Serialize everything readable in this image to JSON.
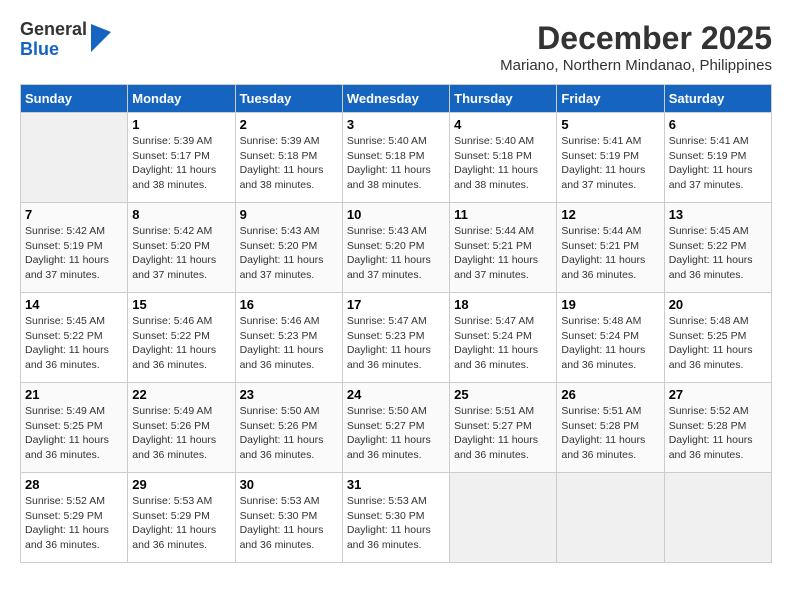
{
  "logo": {
    "general": "General",
    "blue": "Blue"
  },
  "header": {
    "month": "December 2025",
    "location": "Mariano, Northern Mindanao, Philippines"
  },
  "columns": [
    "Sunday",
    "Monday",
    "Tuesday",
    "Wednesday",
    "Thursday",
    "Friday",
    "Saturday"
  ],
  "weeks": [
    [
      {
        "day": "",
        "sunrise": "",
        "sunset": "",
        "daylight": ""
      },
      {
        "day": "1",
        "sunrise": "Sunrise: 5:39 AM",
        "sunset": "Sunset: 5:17 PM",
        "daylight": "Daylight: 11 hours and 38 minutes."
      },
      {
        "day": "2",
        "sunrise": "Sunrise: 5:39 AM",
        "sunset": "Sunset: 5:18 PM",
        "daylight": "Daylight: 11 hours and 38 minutes."
      },
      {
        "day": "3",
        "sunrise": "Sunrise: 5:40 AM",
        "sunset": "Sunset: 5:18 PM",
        "daylight": "Daylight: 11 hours and 38 minutes."
      },
      {
        "day": "4",
        "sunrise": "Sunrise: 5:40 AM",
        "sunset": "Sunset: 5:18 PM",
        "daylight": "Daylight: 11 hours and 38 minutes."
      },
      {
        "day": "5",
        "sunrise": "Sunrise: 5:41 AM",
        "sunset": "Sunset: 5:19 PM",
        "daylight": "Daylight: 11 hours and 37 minutes."
      },
      {
        "day": "6",
        "sunrise": "Sunrise: 5:41 AM",
        "sunset": "Sunset: 5:19 PM",
        "daylight": "Daylight: 11 hours and 37 minutes."
      }
    ],
    [
      {
        "day": "7",
        "sunrise": "Sunrise: 5:42 AM",
        "sunset": "Sunset: 5:19 PM",
        "daylight": "Daylight: 11 hours and 37 minutes."
      },
      {
        "day": "8",
        "sunrise": "Sunrise: 5:42 AM",
        "sunset": "Sunset: 5:20 PM",
        "daylight": "Daylight: 11 hours and 37 minutes."
      },
      {
        "day": "9",
        "sunrise": "Sunrise: 5:43 AM",
        "sunset": "Sunset: 5:20 PM",
        "daylight": "Daylight: 11 hours and 37 minutes."
      },
      {
        "day": "10",
        "sunrise": "Sunrise: 5:43 AM",
        "sunset": "Sunset: 5:20 PM",
        "daylight": "Daylight: 11 hours and 37 minutes."
      },
      {
        "day": "11",
        "sunrise": "Sunrise: 5:44 AM",
        "sunset": "Sunset: 5:21 PM",
        "daylight": "Daylight: 11 hours and 37 minutes."
      },
      {
        "day": "12",
        "sunrise": "Sunrise: 5:44 AM",
        "sunset": "Sunset: 5:21 PM",
        "daylight": "Daylight: 11 hours and 36 minutes."
      },
      {
        "day": "13",
        "sunrise": "Sunrise: 5:45 AM",
        "sunset": "Sunset: 5:22 PM",
        "daylight": "Daylight: 11 hours and 36 minutes."
      }
    ],
    [
      {
        "day": "14",
        "sunrise": "Sunrise: 5:45 AM",
        "sunset": "Sunset: 5:22 PM",
        "daylight": "Daylight: 11 hours and 36 minutes."
      },
      {
        "day": "15",
        "sunrise": "Sunrise: 5:46 AM",
        "sunset": "Sunset: 5:22 PM",
        "daylight": "Daylight: 11 hours and 36 minutes."
      },
      {
        "day": "16",
        "sunrise": "Sunrise: 5:46 AM",
        "sunset": "Sunset: 5:23 PM",
        "daylight": "Daylight: 11 hours and 36 minutes."
      },
      {
        "day": "17",
        "sunrise": "Sunrise: 5:47 AM",
        "sunset": "Sunset: 5:23 PM",
        "daylight": "Daylight: 11 hours and 36 minutes."
      },
      {
        "day": "18",
        "sunrise": "Sunrise: 5:47 AM",
        "sunset": "Sunset: 5:24 PM",
        "daylight": "Daylight: 11 hours and 36 minutes."
      },
      {
        "day": "19",
        "sunrise": "Sunrise: 5:48 AM",
        "sunset": "Sunset: 5:24 PM",
        "daylight": "Daylight: 11 hours and 36 minutes."
      },
      {
        "day": "20",
        "sunrise": "Sunrise: 5:48 AM",
        "sunset": "Sunset: 5:25 PM",
        "daylight": "Daylight: 11 hours and 36 minutes."
      }
    ],
    [
      {
        "day": "21",
        "sunrise": "Sunrise: 5:49 AM",
        "sunset": "Sunset: 5:25 PM",
        "daylight": "Daylight: 11 hours and 36 minutes."
      },
      {
        "day": "22",
        "sunrise": "Sunrise: 5:49 AM",
        "sunset": "Sunset: 5:26 PM",
        "daylight": "Daylight: 11 hours and 36 minutes."
      },
      {
        "day": "23",
        "sunrise": "Sunrise: 5:50 AM",
        "sunset": "Sunset: 5:26 PM",
        "daylight": "Daylight: 11 hours and 36 minutes."
      },
      {
        "day": "24",
        "sunrise": "Sunrise: 5:50 AM",
        "sunset": "Sunset: 5:27 PM",
        "daylight": "Daylight: 11 hours and 36 minutes."
      },
      {
        "day": "25",
        "sunrise": "Sunrise: 5:51 AM",
        "sunset": "Sunset: 5:27 PM",
        "daylight": "Daylight: 11 hours and 36 minutes."
      },
      {
        "day": "26",
        "sunrise": "Sunrise: 5:51 AM",
        "sunset": "Sunset: 5:28 PM",
        "daylight": "Daylight: 11 hours and 36 minutes."
      },
      {
        "day": "27",
        "sunrise": "Sunrise: 5:52 AM",
        "sunset": "Sunset: 5:28 PM",
        "daylight": "Daylight: 11 hours and 36 minutes."
      }
    ],
    [
      {
        "day": "28",
        "sunrise": "Sunrise: 5:52 AM",
        "sunset": "Sunset: 5:29 PM",
        "daylight": "Daylight: 11 hours and 36 minutes."
      },
      {
        "day": "29",
        "sunrise": "Sunrise: 5:53 AM",
        "sunset": "Sunset: 5:29 PM",
        "daylight": "Daylight: 11 hours and 36 minutes."
      },
      {
        "day": "30",
        "sunrise": "Sunrise: 5:53 AM",
        "sunset": "Sunset: 5:30 PM",
        "daylight": "Daylight: 11 hours and 36 minutes."
      },
      {
        "day": "31",
        "sunrise": "Sunrise: 5:53 AM",
        "sunset": "Sunset: 5:30 PM",
        "daylight": "Daylight: 11 hours and 36 minutes."
      },
      {
        "day": "",
        "sunrise": "",
        "sunset": "",
        "daylight": ""
      },
      {
        "day": "",
        "sunrise": "",
        "sunset": "",
        "daylight": ""
      },
      {
        "day": "",
        "sunrise": "",
        "sunset": "",
        "daylight": ""
      }
    ]
  ]
}
